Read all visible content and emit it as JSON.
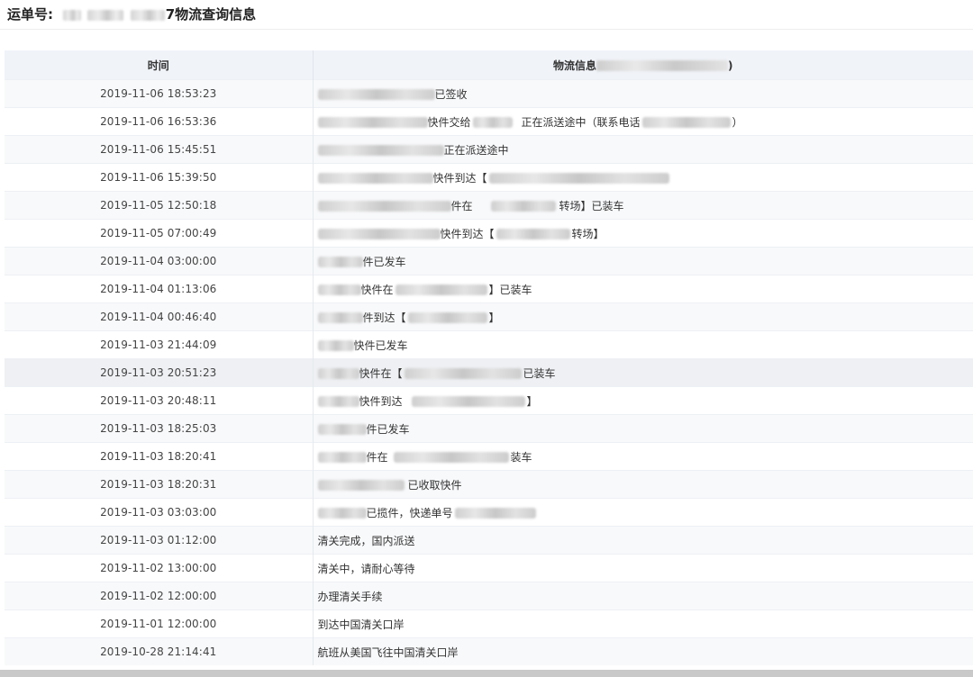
{
  "header": {
    "label": "运单号:",
    "title_suffix": "7物流查询信息"
  },
  "table": {
    "col_time": "时间",
    "col_info": "物流信息",
    "col_info_tail": ")",
    "rows": [
      {
        "time": "2019-11-06 18:53:23",
        "info": "已签收"
      },
      {
        "time": "2019-11-06 16:53:36",
        "info": "快件交给",
        "info2": "正在派送途中（联系电话",
        "info3": "）"
      },
      {
        "time": "2019-11-06 15:45:51",
        "info": "正在派送途中"
      },
      {
        "time": "2019-11-06 15:39:50",
        "info": "快件到达【"
      },
      {
        "time": "2019-11-05 12:50:18",
        "info": "件在",
        "info2": "转场】已装车"
      },
      {
        "time": "2019-11-05 07:00:49",
        "info": "快件到达【",
        "info2": "转场】"
      },
      {
        "time": "2019-11-04 03:00:00",
        "info": "件已发车"
      },
      {
        "time": "2019-11-04 01:13:06",
        "info": "快件在",
        "info2": "】已装车"
      },
      {
        "time": "2019-11-04 00:46:40",
        "info": "件到达【",
        "info2": "】"
      },
      {
        "time": "2019-11-03 21:44:09",
        "info": "快件已发车"
      },
      {
        "time": "2019-11-03 20:51:23",
        "info": "快件在【",
        "info2": "已装车"
      },
      {
        "time": "2019-11-03 20:48:11",
        "info": "快件到达",
        "info2": "】"
      },
      {
        "time": "2019-11-03 18:25:03",
        "info": "件已发车"
      },
      {
        "time": "2019-11-03 18:20:41",
        "info": "件在",
        "info2": "装车"
      },
      {
        "time": "2019-11-03 18:20:31",
        "info": "已收取快件"
      },
      {
        "time": "2019-11-03 03:03:00",
        "info": "已揽件，快递单号"
      },
      {
        "time": "2019-11-03 01:12:00",
        "info": "清关完成，国内派送"
      },
      {
        "time": "2019-11-02 13:00:00",
        "info": "清关中，请耐心等待"
      },
      {
        "time": "2019-11-02 12:00:00",
        "info": "办理清关手续"
      },
      {
        "time": "2019-11-01 12:00:00",
        "info": "到达中国清关口岸"
      },
      {
        "time": "2019-10-28 21:14:41",
        "info": "航班从美国飞往中国清关口岸"
      }
    ]
  }
}
